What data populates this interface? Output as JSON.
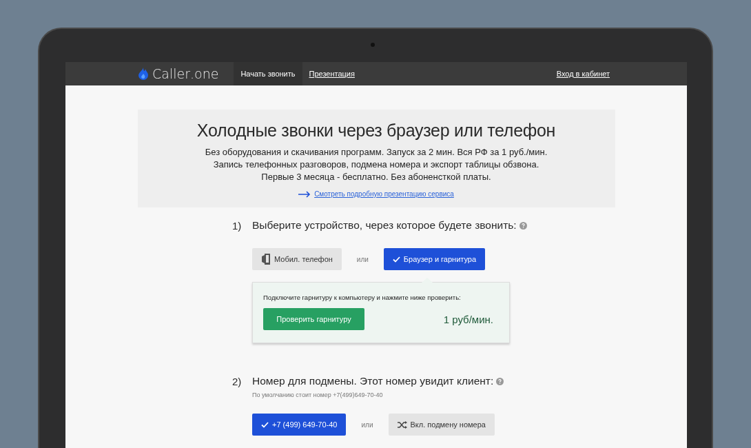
{
  "nav": {
    "logo": {
      "first": "Caller",
      "second": ".one"
    },
    "items": [
      {
        "label": "Начать звонить",
        "selected": true
      },
      {
        "label": "Презентация",
        "selected": false
      }
    ],
    "login": "Вход в кабинет"
  },
  "hero": {
    "title": "Холодные звонки через браузер или телефон",
    "lines": [
      "Без оборудования и скачивания программ. Запуск за 2 мин. Вся РФ за 1 руб./мин.",
      "Запись телефонных разговоров, подмена номера и экспорт таблицы обзвона.",
      "Первые 3 месяца - бесплатно. Без абоненсткой платы."
    ],
    "link": "Смотреть подробную презентацию сервиса"
  },
  "steps": [
    {
      "number": "1)",
      "title": "Выберите устройство, через которое будете звонить:",
      "or": "или",
      "options": [
        {
          "kind": "phone",
          "label": "Мобил. телефон",
          "selected": false
        },
        {
          "kind": "browser",
          "label": "Браузер и гарнитура",
          "selected": true
        }
      ],
      "panel": {
        "text": "Подключите гарнитуру к компьютеру и нажмите ниже проверить:",
        "button": "Проверить гарнитуру",
        "price": "1 руб/мин."
      }
    },
    {
      "number": "2)",
      "title": "Номер для подмены. Этот номер увидит клиент:",
      "hint": "По умолчанию стоит номер +7(499)649-70-40",
      "or": "или",
      "options": [
        {
          "kind": "number",
          "label": "+7 (499) 649-70-40",
          "selected": true
        },
        {
          "kind": "shuffle",
          "label": "Вкл. подмену номера",
          "selected": false
        }
      ]
    }
  ]
}
